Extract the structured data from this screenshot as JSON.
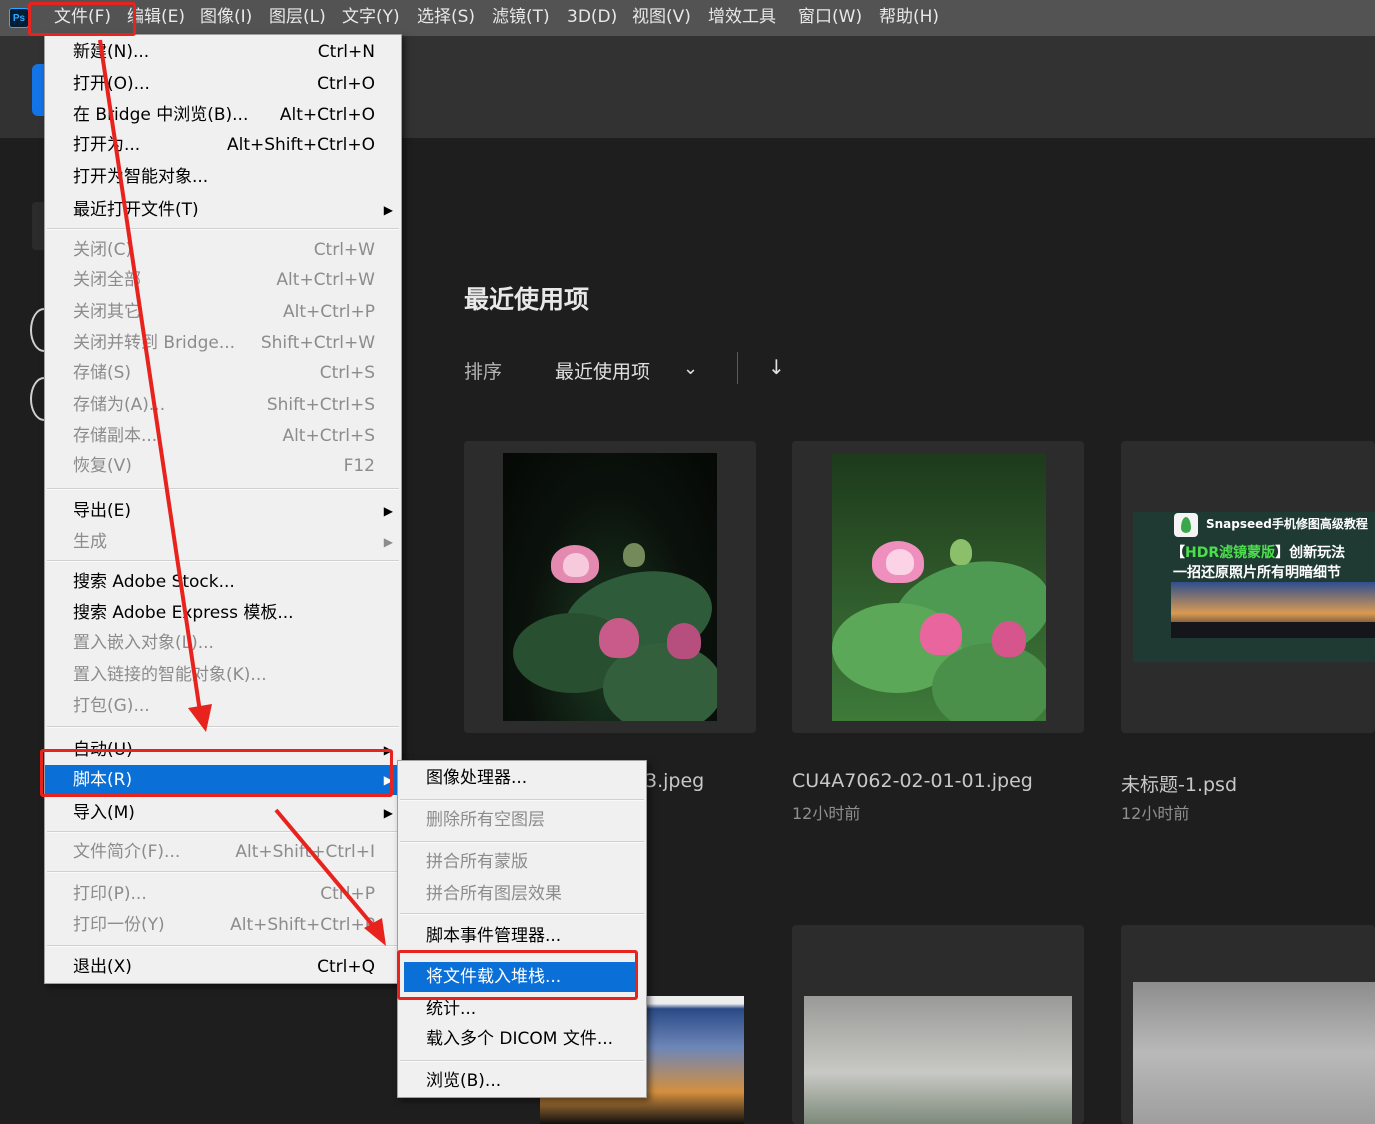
{
  "app": {
    "logo": "Ps"
  },
  "menubar": [
    {
      "label": "文件(F)"
    },
    {
      "label": "编辑(E)"
    },
    {
      "label": "图像(I)"
    },
    {
      "label": "图层(L)"
    },
    {
      "label": "文字(Y)"
    },
    {
      "label": "选择(S)"
    },
    {
      "label": "滤镜(T)"
    },
    {
      "label": "3D(D)"
    },
    {
      "label": "视图(V)"
    },
    {
      "label": "增效工具"
    },
    {
      "label": "窗口(W)"
    },
    {
      "label": "帮助(H)"
    }
  ],
  "home": {
    "section_title": "最近使用项",
    "sort_label": "排序",
    "sort_value": "最近使用项",
    "sort_chevron": "⌄",
    "sort_arrow": "↓",
    "cards": [
      {
        "name": "3.jpeg",
        "time": ""
      },
      {
        "name": "CU4A7062-02-01-01.jpeg",
        "time": "12小时前"
      },
      {
        "name": "未标题-1.psd",
        "time": "12小时前"
      }
    ],
    "snap_thumb": {
      "title": "Snapseed手机修图高级教程",
      "line1_a": "【",
      "line1_hl": "HDR滤镜蒙版",
      "line1_b": "】创新玩法",
      "line2": "一招还原照片所有明暗细节"
    }
  },
  "file_menu": {
    "items": [
      {
        "label": "新建(N)...",
        "shortcut": "Ctrl+N",
        "disabled": false
      },
      {
        "label": "打开(O)...",
        "shortcut": "Ctrl+O",
        "disabled": false
      },
      {
        "label": "在 Bridge 中浏览(B)...",
        "shortcut": "Alt+Ctrl+O",
        "disabled": false
      },
      {
        "label": "打开为...",
        "shortcut": "Alt+Shift+Ctrl+O",
        "disabled": false
      },
      {
        "label": "打开为智能对象...",
        "shortcut": "",
        "disabled": false
      },
      {
        "label": "最近打开文件(T)",
        "shortcut": "",
        "disabled": false,
        "submenu": true
      },
      {
        "label": "关闭(C)",
        "shortcut": "Ctrl+W",
        "disabled": true
      },
      {
        "label": "关闭全部",
        "shortcut": "Alt+Ctrl+W",
        "disabled": true
      },
      {
        "label": "关闭其它",
        "shortcut": "Alt+Ctrl+P",
        "disabled": true
      },
      {
        "label": "关闭并转到 Bridge...",
        "shortcut": "Shift+Ctrl+W",
        "disabled": true
      },
      {
        "label": "存储(S)",
        "shortcut": "Ctrl+S",
        "disabled": true
      },
      {
        "label": "存储为(A)...",
        "shortcut": "Shift+Ctrl+S",
        "disabled": true
      },
      {
        "label": "存储副本...",
        "shortcut": "Alt+Ctrl+S",
        "disabled": true
      },
      {
        "label": "恢复(V)",
        "shortcut": "F12",
        "disabled": true
      },
      {
        "label": "导出(E)",
        "shortcut": "",
        "disabled": false,
        "submenu": true
      },
      {
        "label": "生成",
        "shortcut": "",
        "disabled": true,
        "submenu": true
      },
      {
        "label": "搜索 Adobe Stock...",
        "shortcut": "",
        "disabled": false
      },
      {
        "label": "搜索 Adobe Express 模板...",
        "shortcut": "",
        "disabled": false
      },
      {
        "label": "置入嵌入对象(L)...",
        "shortcut": "",
        "disabled": true
      },
      {
        "label": "置入链接的智能对象(K)...",
        "shortcut": "",
        "disabled": true
      },
      {
        "label": "打包(G)...",
        "shortcut": "",
        "disabled": true
      },
      {
        "label": "自动(U)",
        "shortcut": "",
        "disabled": false,
        "submenu": true
      },
      {
        "label": "脚本(R)",
        "shortcut": "",
        "disabled": false,
        "submenu": true,
        "selected": true
      },
      {
        "label": "导入(M)",
        "shortcut": "",
        "disabled": false,
        "submenu": true
      },
      {
        "label": "文件简介(F)...",
        "shortcut": "Alt+Shift+Ctrl+I",
        "disabled": true
      },
      {
        "label": "打印(P)...",
        "shortcut": "Ctrl+P",
        "disabled": true
      },
      {
        "label": "打印一份(Y)",
        "shortcut": "Alt+Shift+Ctrl+P",
        "disabled": true
      },
      {
        "label": "退出(X)",
        "shortcut": "Ctrl+Q",
        "disabled": false
      }
    ]
  },
  "script_menu": {
    "items": [
      {
        "label": "图像处理器...",
        "disabled": false
      },
      {
        "label": "删除所有空图层",
        "disabled": true
      },
      {
        "label": "拼合所有蒙版",
        "disabled": true
      },
      {
        "label": "拼合所有图层效果",
        "disabled": true
      },
      {
        "label": "脚本事件管理器...",
        "disabled": false
      },
      {
        "label": "将文件载入堆栈...",
        "disabled": false,
        "selected": true
      },
      {
        "label": "统计...",
        "disabled": false
      },
      {
        "label": "载入多个 DICOM 文件...",
        "disabled": false
      },
      {
        "label": "浏览(B)...",
        "disabled": false
      }
    ]
  },
  "submenu_arrow": "▶"
}
